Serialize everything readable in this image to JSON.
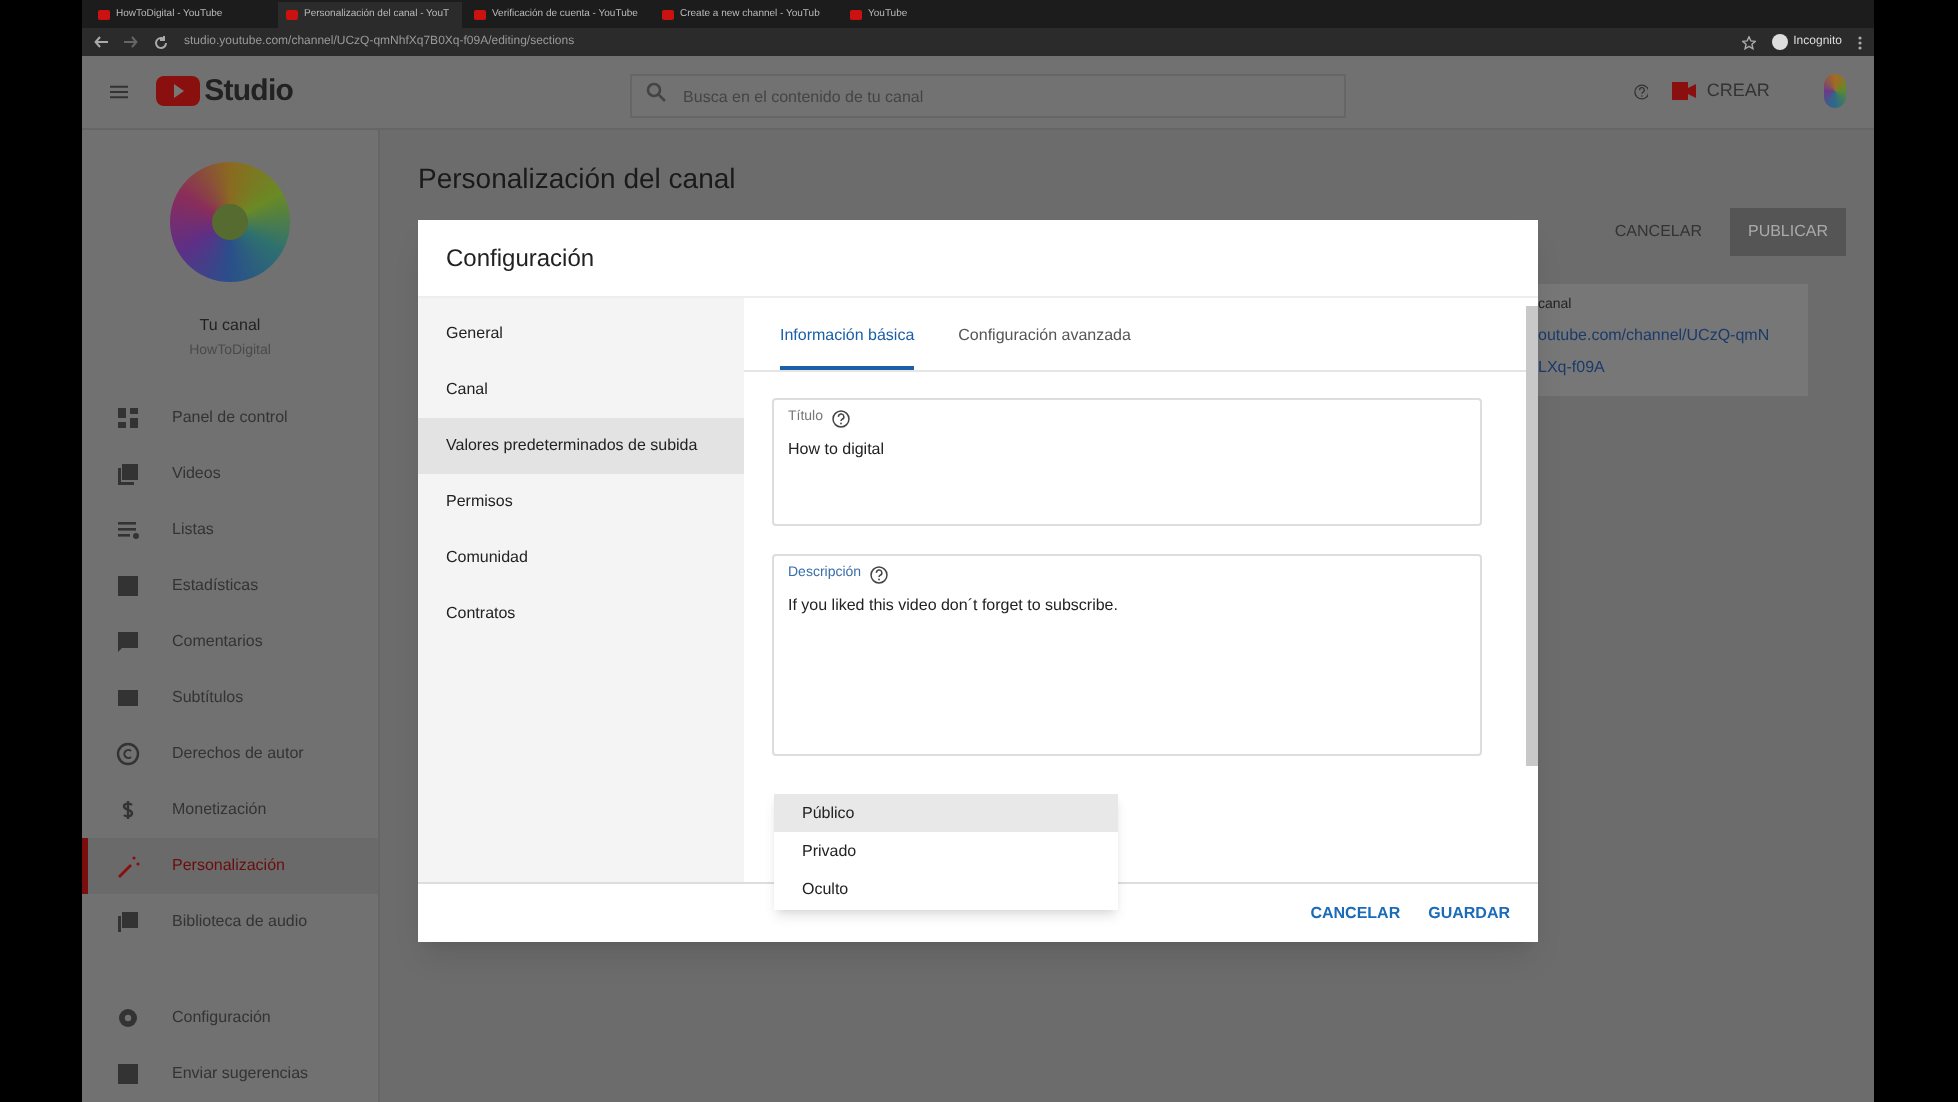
{
  "browser": {
    "tabs": [
      {
        "title": "HowToDigital - YouTube",
        "selected": false
      },
      {
        "title": "Personalización del canal - YouT",
        "selected": true
      },
      {
        "title": "Verificación de cuenta - YouTube",
        "selected": false
      },
      {
        "title": "Create a new channel - YouTub",
        "selected": false
      },
      {
        "title": "YouTube",
        "selected": false
      }
    ],
    "url": "studio.youtube.com/channel/UCzQ-qmNhfXq7B0Xq-f09A/editing/sections",
    "profile": "Incognito"
  },
  "header": {
    "logo": "Studio",
    "search_placeholder": "Busca en el contenido de tu canal",
    "create_button": "CREAR"
  },
  "sidebar": {
    "channel_name": "Tu canal",
    "channel_handle": "HowToDigital",
    "items": [
      {
        "label": "Panel de control",
        "selected": false
      },
      {
        "label": "Videos",
        "selected": false
      },
      {
        "label": "Listas",
        "selected": false
      },
      {
        "label": "Estadísticas",
        "selected": false
      },
      {
        "label": "Comentarios",
        "selected": false
      },
      {
        "label": "Subtítulos",
        "selected": false
      },
      {
        "label": "Derechos de autor",
        "selected": false
      },
      {
        "label": "Monetización",
        "selected": false
      },
      {
        "label": "Personalización",
        "selected": true
      },
      {
        "label": "Biblioteca de audio",
        "selected": false
      }
    ],
    "bottom_items": [
      {
        "label": "Configuración"
      },
      {
        "label": "Enviar sugerencias"
      }
    ]
  },
  "page": {
    "title": "Personalización del canal",
    "buttons": [
      "CANCELAR",
      "PUBLICAR"
    ],
    "card_heading": "canal",
    "card_link_lines": [
      "outube.com/channel/UCzQ-qmN",
      "LXq-f09A"
    ]
  },
  "dialog": {
    "title": "Configuración",
    "nav": [
      {
        "label": "General",
        "selected": false
      },
      {
        "label": "Canal",
        "selected": false
      },
      {
        "label": "Valores predeterminados de subida",
        "selected": true
      },
      {
        "label": "Permisos",
        "selected": false
      },
      {
        "label": "Comunidad",
        "selected": false
      },
      {
        "label": "Contratos",
        "selected": false
      }
    ],
    "tabs": [
      {
        "label": "Información básica",
        "selected": true
      },
      {
        "label": "Configuración avanzada",
        "selected": false
      }
    ],
    "fields": [
      {
        "label": "Título",
        "value": "How to digital",
        "kind": "short"
      },
      {
        "label": "Descripción",
        "value": "If you liked this video don´t forget to subscribe.",
        "kind": "long"
      }
    ],
    "visibility_menu": [
      {
        "label": "Público",
        "selected": true
      },
      {
        "label": "Privado",
        "selected": false
      },
      {
        "label": "Oculto",
        "selected": false
      }
    ],
    "buttons": [
      "CANCELAR",
      "GUARDAR"
    ]
  }
}
